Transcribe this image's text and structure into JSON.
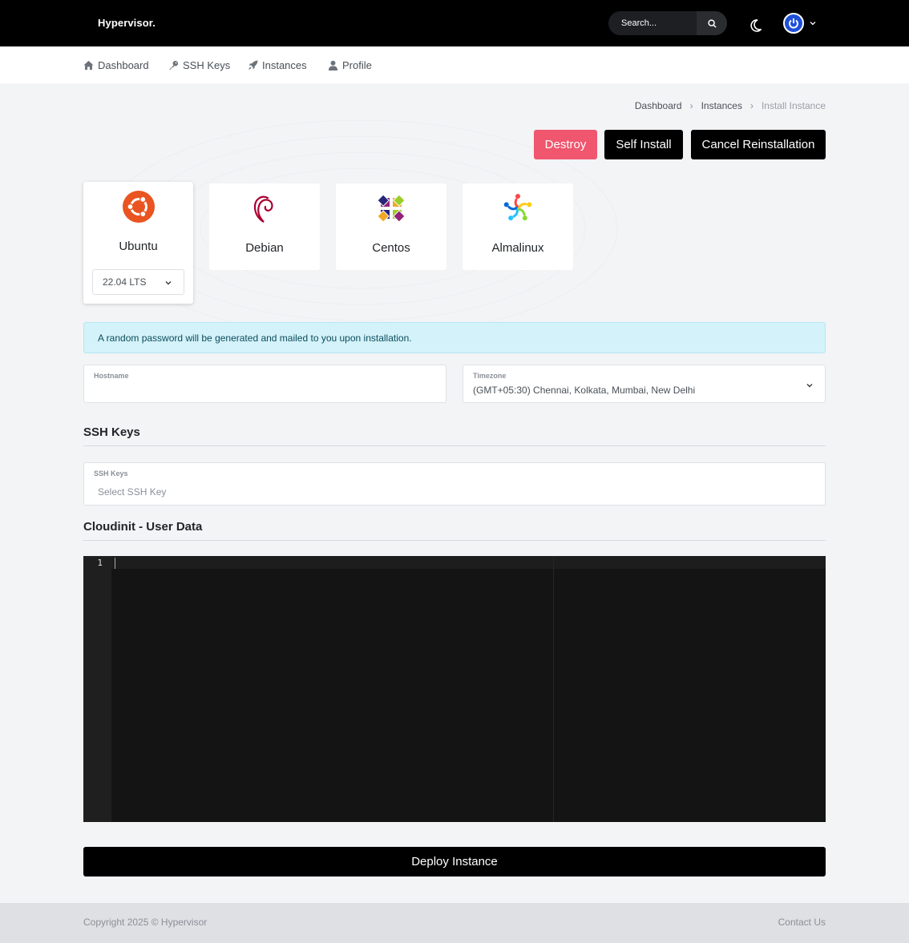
{
  "brand": "Hypervisor.",
  "search": {
    "placeholder": "Search..."
  },
  "nav": [
    {
      "label": "Dashboard",
      "icon": "home-icon"
    },
    {
      "label": "SSH Keys",
      "icon": "key-icon"
    },
    {
      "label": "Instances",
      "icon": "rocket-icon"
    },
    {
      "label": "Profile",
      "icon": "user-icon"
    }
  ],
  "breadcrumb": [
    "Dashboard",
    "Instances",
    "Install Instance"
  ],
  "actions": {
    "destroy": "Destroy",
    "self_install": "Self Install",
    "cancel_reinstall": "Cancel Reinstallation"
  },
  "os_options": [
    {
      "name": "Ubuntu",
      "icon": "ubuntu-logo-icon",
      "selected": true,
      "version": "22.04 LTS"
    },
    {
      "name": "Debian",
      "icon": "debian-logo-icon"
    },
    {
      "name": "Centos",
      "icon": "centos-logo-icon"
    },
    {
      "name": "Almalinux",
      "icon": "almalinux-logo-icon"
    }
  ],
  "alert": "A random password will be generated and mailed to you upon installation.",
  "hostname": {
    "label": "Hostname",
    "value": ""
  },
  "timezone": {
    "label": "Timezone",
    "value": "(GMT+05:30) Chennai, Kolkata, Mumbai, New Delhi"
  },
  "ssh_section": {
    "title": "SSH Keys",
    "label": "SSH Keys",
    "placeholder": "Select SSH Key"
  },
  "cloudinit_section": {
    "title": "Cloudinit - User Data",
    "line_numbers": [
      "1"
    ]
  },
  "deploy": "Deploy Instance",
  "footer": {
    "copyright": "Copyright 2025 © Hypervisor",
    "contact": "Contact Us"
  },
  "colors": {
    "destroy": "#f0566e",
    "alert_bg": "#d4f2f9",
    "avatar": "#1e4fd8",
    "ubuntu": "#e95420"
  }
}
